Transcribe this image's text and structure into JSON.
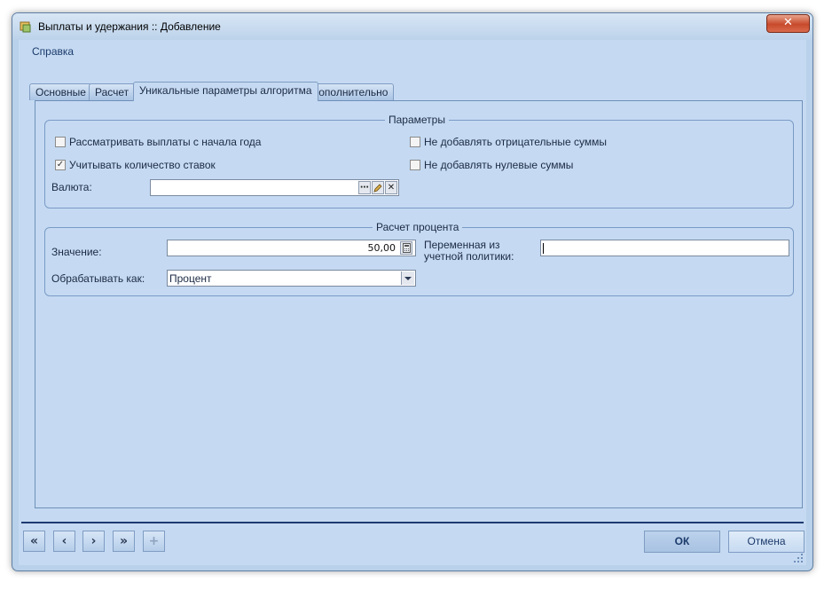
{
  "window": {
    "title": "Выплаты и удержания :: Добавление",
    "close_glyph": "✕"
  },
  "menu": {
    "help": "Справка"
  },
  "tabs": [
    {
      "label": "Основные"
    },
    {
      "label": "Расчет"
    },
    {
      "label": "Уникальные параметры алгоритма"
    },
    {
      "label": "Дополнительно"
    }
  ],
  "params": {
    "title": "Параметры",
    "chk_from_year_start": {
      "label": "Рассматривать выплаты с начала года",
      "checked": false
    },
    "chk_count_rates": {
      "label": "Учитывать количество ставок",
      "checked": true
    },
    "chk_no_negative": {
      "label": "Не добавлять отрицательные суммы",
      "checked": false
    },
    "chk_no_zero": {
      "label": "Не добавлять нулевые суммы",
      "checked": false
    },
    "currency_label": "Валюта:",
    "currency_value": "",
    "currency_btn_browse": "⋯",
    "currency_btn_clear": "✕"
  },
  "percent": {
    "title": "Расчет процента",
    "value_label": "Значение:",
    "value": "50,00",
    "policy_var_label_1": "Переменная из",
    "policy_var_label_2": "учетной политики:",
    "policy_var_value": "",
    "process_as_label": "Обрабатывать как:",
    "process_as_value": "Процент"
  },
  "footer": {
    "nav_first": "«",
    "nav_prev": "‹",
    "nav_next": "›",
    "nav_last": "»",
    "nav_add": "+",
    "ok": "ОК",
    "cancel": "Отмена"
  }
}
